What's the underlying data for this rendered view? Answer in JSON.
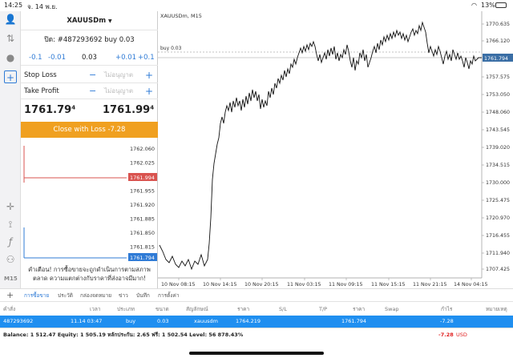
{
  "status_bar": {
    "time": "14:25",
    "date": "จ. 14 พ.ย.",
    "battery": "13%"
  },
  "panel": {
    "symbol": "XAUUSDm",
    "order_title": "ปิด: #487293692 buy 0.03",
    "volume": {
      "minus_big": "-0.1",
      "minus_small": "-0.01",
      "value": "0.03",
      "plus_small": "+0.01",
      "plus_big": "+0.1"
    },
    "stop_loss": {
      "label": "Stop Loss",
      "value": "ไม่อนุญาต"
    },
    "take_profit": {
      "label": "Take Profit",
      "value": "ไม่อนุญาต"
    },
    "bid": {
      "main": "1761.79",
      "small": "4"
    },
    "ask": {
      "main": "1761.99",
      "small": "4"
    },
    "close_button": "Close with Loss -7.28",
    "tick_prices": [
      "1762.060",
      "1762.025",
      "1761.990",
      "1761.955",
      "1761.920",
      "1761.885",
      "1761.850",
      "1761.815",
      "1761.794"
    ],
    "ask_label": "1761.994",
    "bid_label": "1761.794",
    "warning": "คำเตือน! การซื้อขายจะถูกดำเนินการตามสภาพตลาด ความแตกต่างกับราคาที่ส่งอาจมีมาก!"
  },
  "rail": {
    "tf": "M15"
  },
  "chart": {
    "title": "XAUUSDm, M15",
    "order_line_label": "buy 0.03",
    "price_label": "1761.794",
    "y_ticks": [
      "1770.635",
      "1766.120",
      "1761.794",
      "1757.575",
      "1753.050",
      "1748.060",
      "1743.545",
      "1739.020",
      "1734.515",
      "1730.000",
      "1725.475",
      "1720.970",
      "1716.455",
      "1711.940",
      "1707.425"
    ],
    "x_ticks": [
      "10 Nov 08:15",
      "10 Nov 14:15",
      "10 Nov 20:15",
      "11 Nov 03:15",
      "11 Nov 09:15",
      "11 Nov 15:15",
      "11 Nov 21:15",
      "14 Nov 04:15"
    ]
  },
  "tabs": [
    "การซื้อขาย",
    "ประวัติ",
    "กล่องจดหมาย",
    "ข่าว",
    "บันทึก",
    "การตั้งค่า"
  ],
  "table": {
    "headers": [
      "คำสั่ง",
      "เวลา",
      "ประเภท",
      "ขนาด",
      "สัญลักษณ์",
      "ราคา",
      "S/L",
      "T/P",
      "ราคา",
      "Swap",
      "กำไร",
      "หมายเหตุ"
    ],
    "row": [
      "487293692",
      "11.14 03:47",
      "buy",
      "0.03",
      "xauusdm",
      "1764.219",
      "",
      "",
      "1761.794",
      "",
      "-7.28",
      ""
    ]
  },
  "balance": {
    "text": "Balance: 1 512.47 Equity: 1 505.19 หลักประกัน: 2.65 ฟรี: 1 502.54 Level: 56 878.43%",
    "profit": "-7.28",
    "currency": "USD"
  },
  "colors": {
    "accent": "#2f7bd6",
    "close_button": "#f0a020",
    "ask": "#d9534f",
    "bid": "#2f7bd6",
    "row_selected": "#1f8ff0",
    "loss": "#e02020"
  }
}
